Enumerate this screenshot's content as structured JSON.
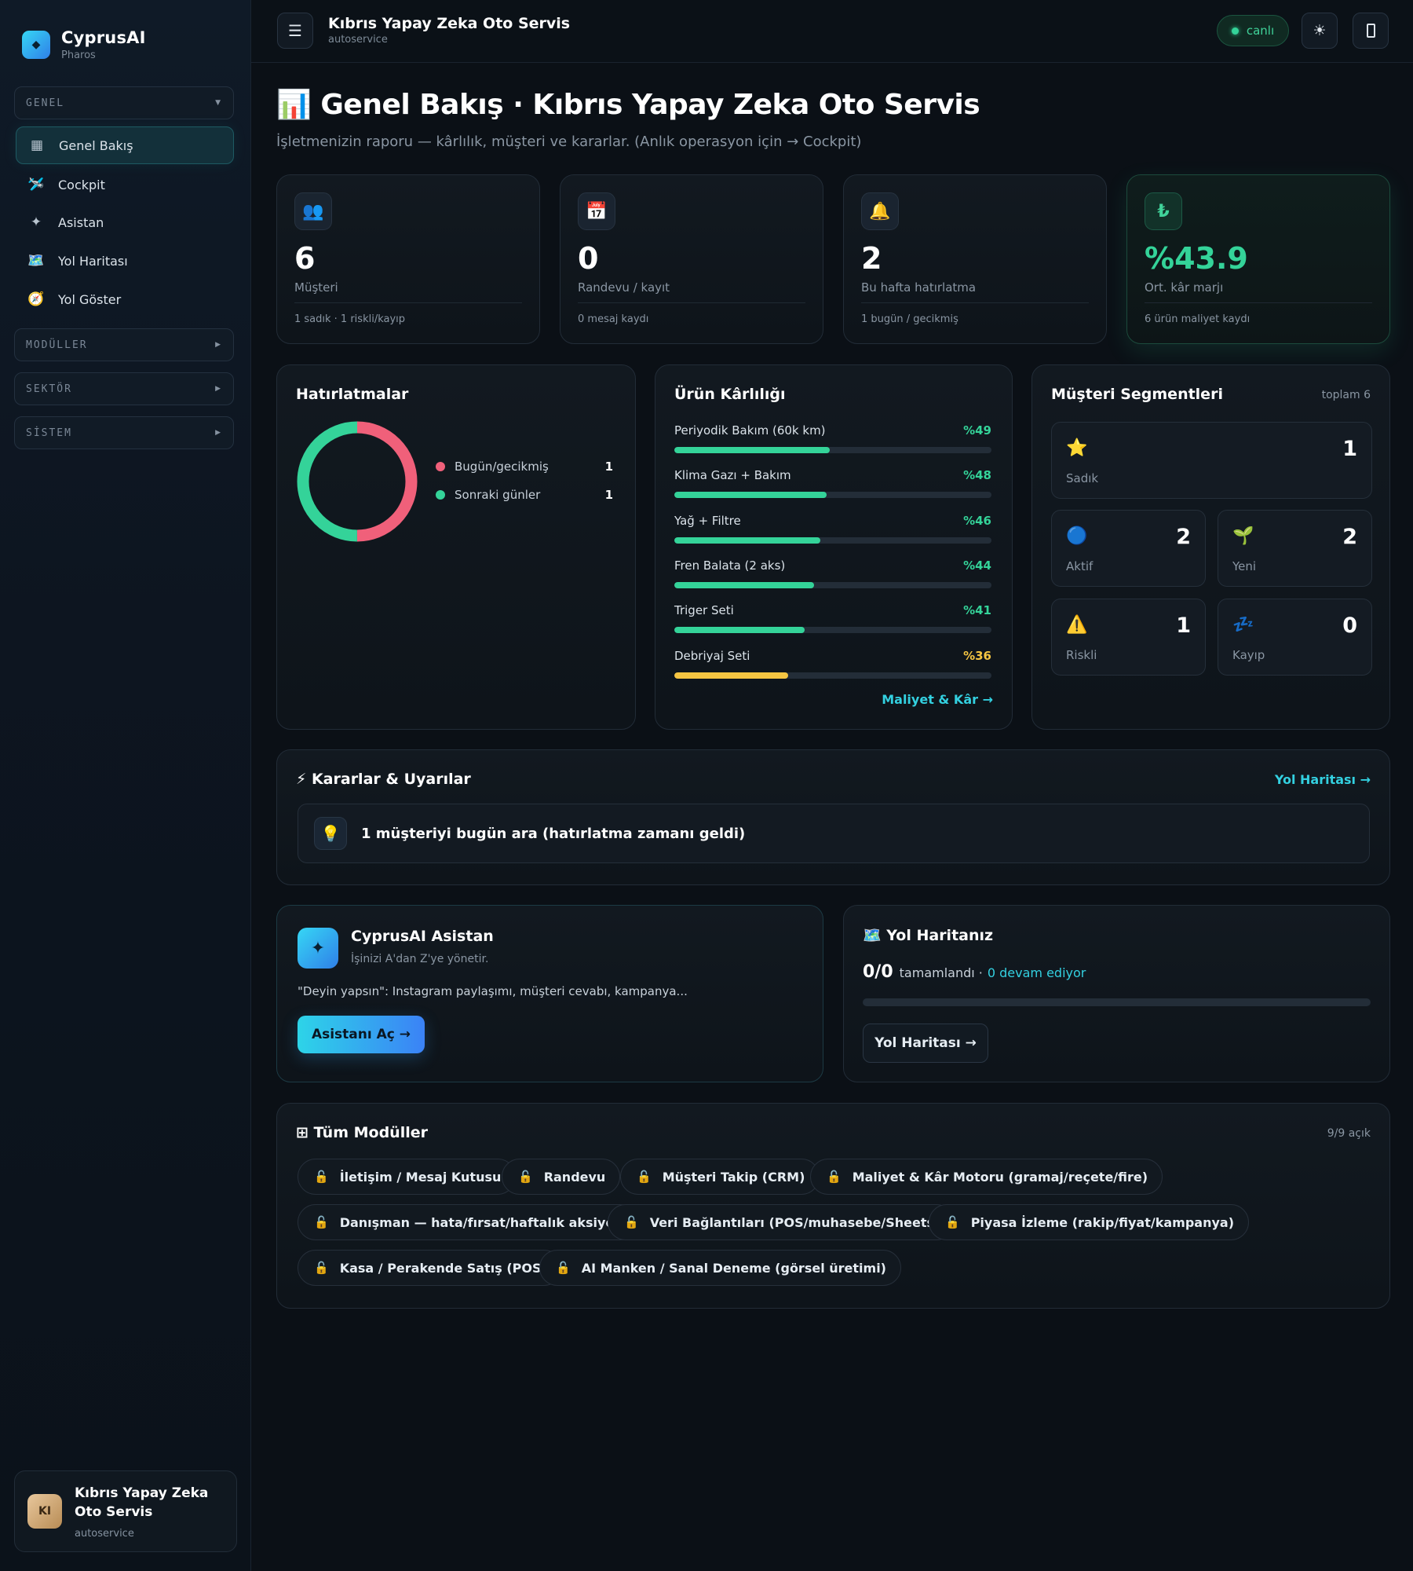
{
  "sidebar": {
    "brand_name": "CyprusAI",
    "brand_sub": "Pharos",
    "groups": {
      "genel": "GENEL",
      "moduller": "MODÜLLER",
      "sektor": "SEKTÖR",
      "sistem": "SİSTEM"
    },
    "items": [
      {
        "label": "Genel Bakış",
        "icon": "grid-icon"
      },
      {
        "label": "Cockpit",
        "icon": "airplane-icon"
      },
      {
        "label": "Asistan",
        "icon": "sparkle-icon"
      },
      {
        "label": "Yol Haritası",
        "icon": "map-icon"
      },
      {
        "label": "Yol Göster",
        "icon": "compass-icon"
      }
    ],
    "user": {
      "initials": "KI",
      "name": "Kıbrıs Yapay Zeka Oto Servis",
      "sub": "autoservice"
    }
  },
  "topbar": {
    "title": "Kıbrıs Yapay Zeka Oto Servis",
    "sub": "autoservice",
    "live_label": "canlı"
  },
  "page": {
    "title": "📊 Genel Bakış · Kıbrıs Yapay Zeka Oto Servis",
    "subtitle": "İşletmenizin raporu — kârlılık, müşteri ve kararlar. (Anlık operasyon için → Cockpit)"
  },
  "kpis": [
    {
      "icon": "people-icon",
      "value": "6",
      "label": "Müşteri",
      "foot": "1 sadık · 1 riskli/kayıp"
    },
    {
      "icon": "calendar-icon",
      "value": "0",
      "label": "Randevu / kayıt",
      "foot": "0 mesaj kaydı"
    },
    {
      "icon": "bell-icon",
      "value": "2",
      "label": "Bu hafta hatırlatma",
      "foot": "1 bugün / gecikmiş"
    },
    {
      "icon": "lira-icon",
      "value": "%43.9",
      "label": "Ort. kâr marjı",
      "foot": "6 ürün maliyet kaydı"
    }
  ],
  "reminders": {
    "title": "Hatırlatmalar",
    "items": [
      {
        "label": "Bugün/gecikmiş",
        "value": "1",
        "color": "#f0607a"
      },
      {
        "label": "Sonraki günler",
        "value": "1",
        "color": "#34d399"
      }
    ]
  },
  "profit": {
    "title": "Ürün Kârlılığı",
    "link": "Maliyet & Kâr →",
    "items": [
      {
        "name": "Periyodik Bakım (60k km)",
        "pct_label": "%49",
        "pct": 49,
        "color": "#34d399"
      },
      {
        "name": "Klima Gazı + Bakım",
        "pct_label": "%48",
        "pct": 48,
        "color": "#34d399"
      },
      {
        "name": "Yağ + Filtre",
        "pct_label": "%46",
        "pct": 46,
        "color": "#34d399"
      },
      {
        "name": "Fren Balata (2 aks)",
        "pct_label": "%44",
        "pct": 44,
        "color": "#34d399"
      },
      {
        "name": "Triger Seti",
        "pct_label": "%41",
        "pct": 41,
        "color": "#34d399"
      },
      {
        "name": "Debriyaj Seti",
        "pct_label": "%36",
        "pct": 36,
        "color": "#f5c542"
      }
    ]
  },
  "segments": {
    "title": "Müşteri Segmentleri",
    "total": "toplam 6",
    "items": [
      {
        "label": "Sadık",
        "value": "1",
        "icon": "star-icon"
      },
      {
        "label": "Aktif",
        "value": "2",
        "icon": "blue-circle-icon"
      },
      {
        "label": "Yeni",
        "value": "2",
        "icon": "seedling-icon"
      },
      {
        "label": "Riskli",
        "value": "1",
        "icon": "warning-icon"
      },
      {
        "label": "Kayıp",
        "value": "0",
        "icon": "sleep-icon"
      }
    ]
  },
  "decisions": {
    "title": "⚡ Kararlar & Uyarılar",
    "link": "Yol Haritası →",
    "alert": "1 müşteriyi bugün ara (hatırlatma zamanı geldi)"
  },
  "assistant": {
    "title": "CyprusAI Asistan",
    "sub": "İşinizi A'dan Z'ye yönetir.",
    "desc": "\"Deyin yapsın\": Instagram paylaşımı, müşteri cevabı, kampanya...",
    "button": "Asistanı Aç →"
  },
  "roadmap": {
    "title": "🗺️ Yol Haritanız",
    "count": "0/0",
    "done_label": "tamamlandı ·",
    "ongoing": "0 devam ediyor",
    "progress": 0,
    "button": "Yol Haritası →"
  },
  "modules": {
    "title": "⊞ Tüm Modüller",
    "count": "9/9 açık",
    "items": [
      "İletişim / Mesaj Kutusu",
      "Randevu",
      "Müşteri Takip (CRM)",
      "Maliyet & Kâr Motoru (gramaj/reçete/fire)",
      "Danışman — hata/fırsat/haftalık aksiyon",
      "Veri Bağlantıları (POS/muhasebe/Sheets)",
      "Piyasa İzleme (rakip/fiyat/kampanya)",
      "Kasa / Perakende Satış (POS)",
      "AI Manken / Sanal Deneme (görsel üretimi)"
    ]
  },
  "colors": {
    "accent": "#33d0e0",
    "green": "#34d399",
    "red": "#f0607a",
    "yellow": "#f5c542"
  }
}
